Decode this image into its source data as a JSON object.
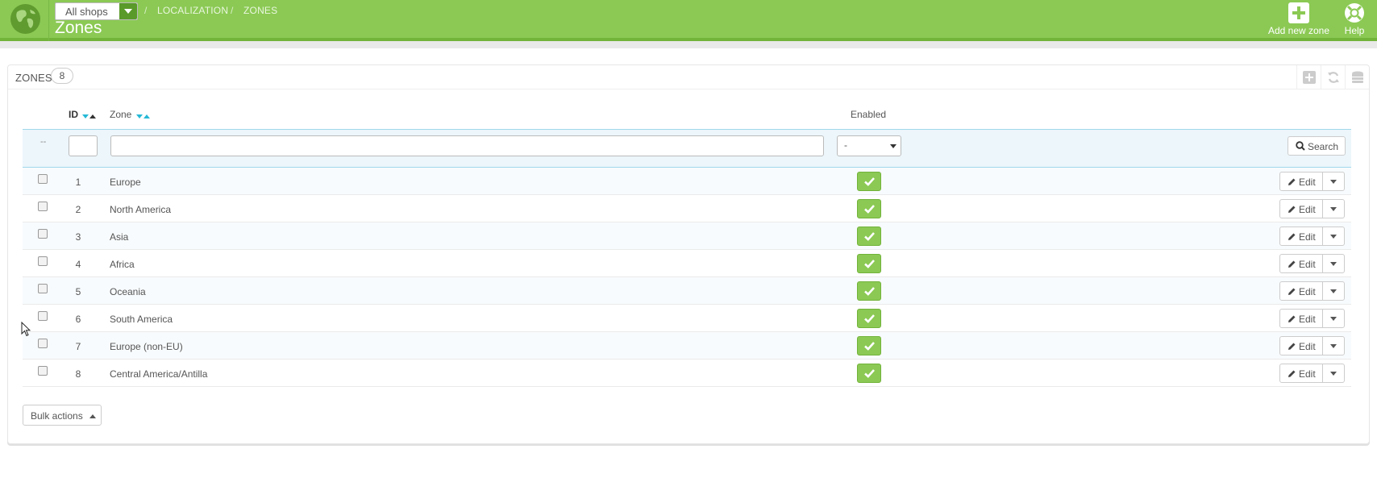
{
  "header": {
    "shop_select": "All shops",
    "breadcrumb": [
      "LOCALIZATION",
      "ZONES"
    ],
    "title": "Zones",
    "add_label": "Add new zone",
    "help_label": "Help"
  },
  "panel": {
    "title": "ZONES",
    "count": "8"
  },
  "table": {
    "columns": {
      "id": "ID",
      "zone": "Zone",
      "enabled": "Enabled"
    },
    "filter": {
      "dash": "--",
      "enabled_value": "-",
      "search_label": "Search"
    },
    "rows": [
      {
        "id": "1",
        "zone": "Europe",
        "enabled": true
      },
      {
        "id": "2",
        "zone": "North America",
        "enabled": true
      },
      {
        "id": "3",
        "zone": "Asia",
        "enabled": true
      },
      {
        "id": "4",
        "zone": "Africa",
        "enabled": true
      },
      {
        "id": "5",
        "zone": "Oceania",
        "enabled": true
      },
      {
        "id": "6",
        "zone": "South America",
        "enabled": true
      },
      {
        "id": "7",
        "zone": "Europe (non-EU)",
        "enabled": true
      },
      {
        "id": "8",
        "zone": "Central America/Antilla",
        "enabled": true
      }
    ],
    "edit_label": "Edit",
    "bulk_label": "Bulk actions"
  },
  "colors": {
    "header": "#8bc954",
    "accent": "#25b9d7",
    "enabled": "#8bc954"
  },
  "icons": [
    "globe-icon",
    "plus-icon",
    "lifebuoy-icon",
    "search-icon",
    "pencil-icon",
    "check-icon",
    "refresh-icon",
    "database-icon"
  ]
}
